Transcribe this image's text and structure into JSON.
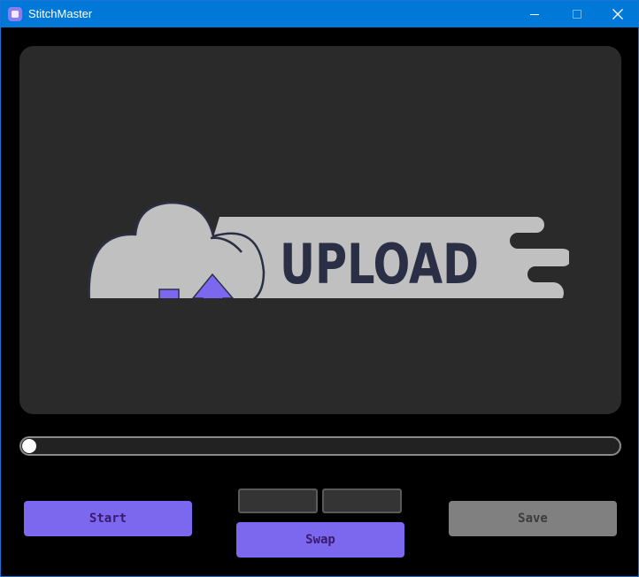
{
  "window": {
    "title": "StitchMaster",
    "icon": "app-icon",
    "controls": [
      "minimize-icon",
      "maximize-icon",
      "close-icon"
    ]
  },
  "preview": {
    "placeholder_text": "UPLOAD",
    "icon": "cloud-upload-icon"
  },
  "progress": {
    "value": 0
  },
  "inputs": {
    "first": {
      "value": ""
    },
    "second": {
      "value": ""
    }
  },
  "buttons": {
    "start": "Start",
    "swap": "Swap",
    "save": "Save"
  },
  "colors": {
    "accent": "#7b68ee",
    "disabled": "#808080",
    "panel": "#2a2a2a",
    "titlebar": "#0078d7",
    "upload_text": "#2b2f45",
    "cloud": "#c0c0c0"
  }
}
